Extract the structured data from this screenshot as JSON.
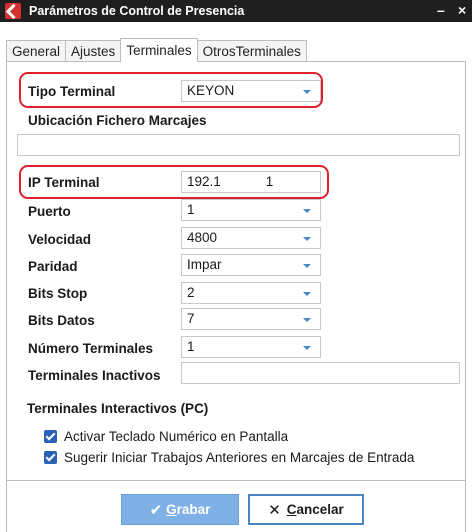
{
  "window": {
    "title": "Parámetros de Control de Presencia",
    "minimize": "–",
    "close": "×"
  },
  "tabs": [
    {
      "label": "General",
      "active": false
    },
    {
      "label": "Ajustes",
      "active": false
    },
    {
      "label": "Terminales",
      "active": true
    },
    {
      "label": "OtrosTerminales",
      "active": false
    }
  ],
  "form": {
    "tipo_terminal": {
      "label": "Tipo Terminal",
      "value": "KEYON"
    },
    "ubicacion": {
      "label": "Ubicación Fichero Marcajes",
      "value": ""
    },
    "ip_terminal": {
      "label": "IP Terminal",
      "value": "192.1            1"
    },
    "puerto": {
      "label": "Puerto",
      "value": "1"
    },
    "velocidad": {
      "label": "Velocidad",
      "value": "4800"
    },
    "paridad": {
      "label": "Paridad",
      "value": "Impar"
    },
    "bits_stop": {
      "label": "Bits Stop",
      "value": "2"
    },
    "bits_datos": {
      "label": "Bits Datos",
      "value": "7"
    },
    "numero_terminales": {
      "label": "Número Terminales",
      "value": "1"
    },
    "terminales_inactivos": {
      "label": "Terminales Inactivos",
      "value": ""
    }
  },
  "interactivos": {
    "heading": "Terminales Interactivos (PC)",
    "options": [
      {
        "label": "Activar Teclado Numérico en Pantalla",
        "checked": true
      },
      {
        "label": "Sugerir Iniciar Trabajos Anteriores en Marcajes de Entrada",
        "checked": true
      }
    ]
  },
  "buttons": {
    "save_first": "G",
    "save_rest": "rabar",
    "cancel_first": "C",
    "cancel_rest": "ancelar"
  },
  "colors": {
    "highlight": "#e0202a",
    "accent": "#4a86c5",
    "save_bg": "#7fb1e6",
    "titlebar": "#1f1f1f"
  }
}
